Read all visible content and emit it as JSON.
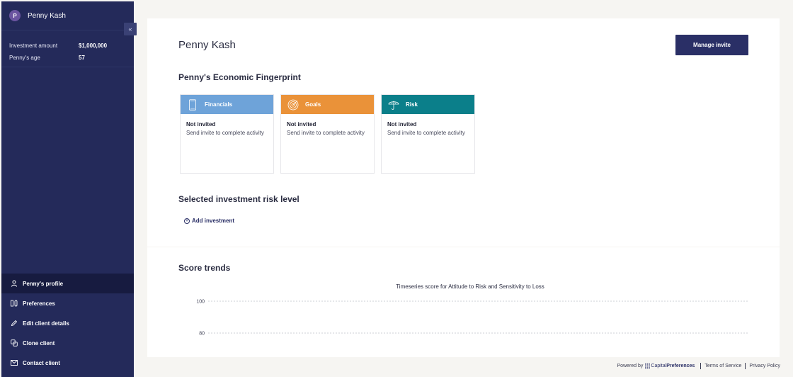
{
  "client": {
    "name": "Penny Kash",
    "avatar_initial": "P"
  },
  "sidebar": {
    "collapse_label": "«",
    "info": [
      {
        "label": "Investment amount",
        "value": "$1,000,000"
      },
      {
        "label": "Penny's age",
        "value": "57"
      }
    ],
    "nav": [
      {
        "label": "Penny's profile",
        "icon": "user-icon",
        "active": true
      },
      {
        "label": "Preferences",
        "icon": "preferences-icon",
        "active": false
      },
      {
        "label": "Edit client details",
        "icon": "pencil-icon",
        "active": false
      },
      {
        "label": "Clone client",
        "icon": "clone-icon",
        "active": false
      },
      {
        "label": "Contact client",
        "icon": "mail-icon",
        "active": false
      }
    ]
  },
  "main": {
    "title": "Penny Kash",
    "manage_invite_label": "Manage invite",
    "fingerprint_title": "Penny's Economic Fingerprint",
    "cards": [
      {
        "title": "Financials",
        "icon": "phone-icon",
        "color": "#6ea3d9",
        "status": "Not invited",
        "desc": "Send invite to complete activity"
      },
      {
        "title": "Goals",
        "icon": "target-icon",
        "color": "#ea9239",
        "status": "Not invited",
        "desc": "Send invite to complete activity"
      },
      {
        "title": "Risk",
        "icon": "umbrella-icon",
        "color": "#0b7f8a",
        "status": "Not invited",
        "desc": "Send invite to complete activity"
      }
    ],
    "risk_title": "Selected investment risk level",
    "add_investment_label": "Add investment"
  },
  "trends": {
    "title": "Score trends",
    "chart_title": "Timeseries score for Attitude to Risk and Sensitivity to Loss"
  },
  "chart_data": {
    "type": "line",
    "title": "Timeseries score for Attitude to Risk and Sensitivity to Loss",
    "yticks": [
      100,
      80
    ],
    "ylim": [
      80,
      100
    ],
    "grid": true,
    "series": []
  },
  "footer": {
    "powered_by": "Powered by",
    "brand_light": "Capital",
    "brand_bold": "Preferences",
    "terms": "Terms of Service",
    "privacy": "Privacy Policy"
  },
  "colors": {
    "sidebar_bg": "#242a5a",
    "sidebar_active": "#171b40",
    "primary_button": "#2a2f66"
  }
}
